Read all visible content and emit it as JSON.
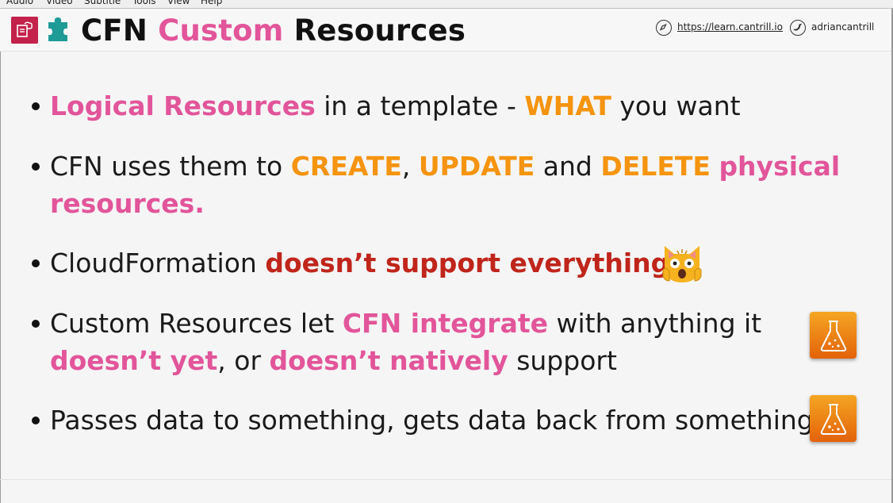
{
  "menubar": {
    "items": [
      "Audio",
      "Video",
      "Subtitle",
      "Tools",
      "View",
      "Help"
    ]
  },
  "header": {
    "title_part1": "CFN",
    "title_part2": "Custom",
    "title_part3": "Resources",
    "link_url": "https://learn.cantrill.io",
    "twitter_handle": "adriancantrill",
    "icons": [
      "cloudformation-icon",
      "puzzle-icon",
      "compass-icon",
      "twitter-icon"
    ]
  },
  "colors": {
    "pink": "#e2559a",
    "orange": "#f5940f",
    "red": "#c0251b",
    "app_icon": "#c3224a",
    "lab_icon": "#f5a623"
  },
  "bullets": [
    {
      "line1": {
        "pink1": "Logical Resources",
        "text1": " in a template - ",
        "orange1": "WHAT",
        "text2": " you want"
      }
    },
    {
      "line1": {
        "text1": "CFN uses them to ",
        "orange1": "CREATE",
        "text2": ", ",
        "orange2": "UPDATE",
        "text3": " and ",
        "orange3": "DELETE",
        "text4": " ",
        "pink1": "physical"
      },
      "line2": {
        "pink1": "resources."
      }
    },
    {
      "line1": {
        "text1": "CloudFormation ",
        "red1": "doesn’t support everything",
        "text2": "…"
      },
      "emoji": "scared-cat-icon"
    },
    {
      "line1": {
        "text1": "Custom Resources let ",
        "pink1": "CFN integrate",
        "text2": " with anything it"
      },
      "line2": {
        "pink1": "doesn’t yet",
        "text1": ", or ",
        "pink2": "doesn’t natively",
        "text2": " support"
      },
      "icon": "lab-flask-icon"
    },
    {
      "line1": {
        "text1": "Passes data to something, gets data back from something"
      },
      "icon": "lab-flask-icon"
    }
  ]
}
